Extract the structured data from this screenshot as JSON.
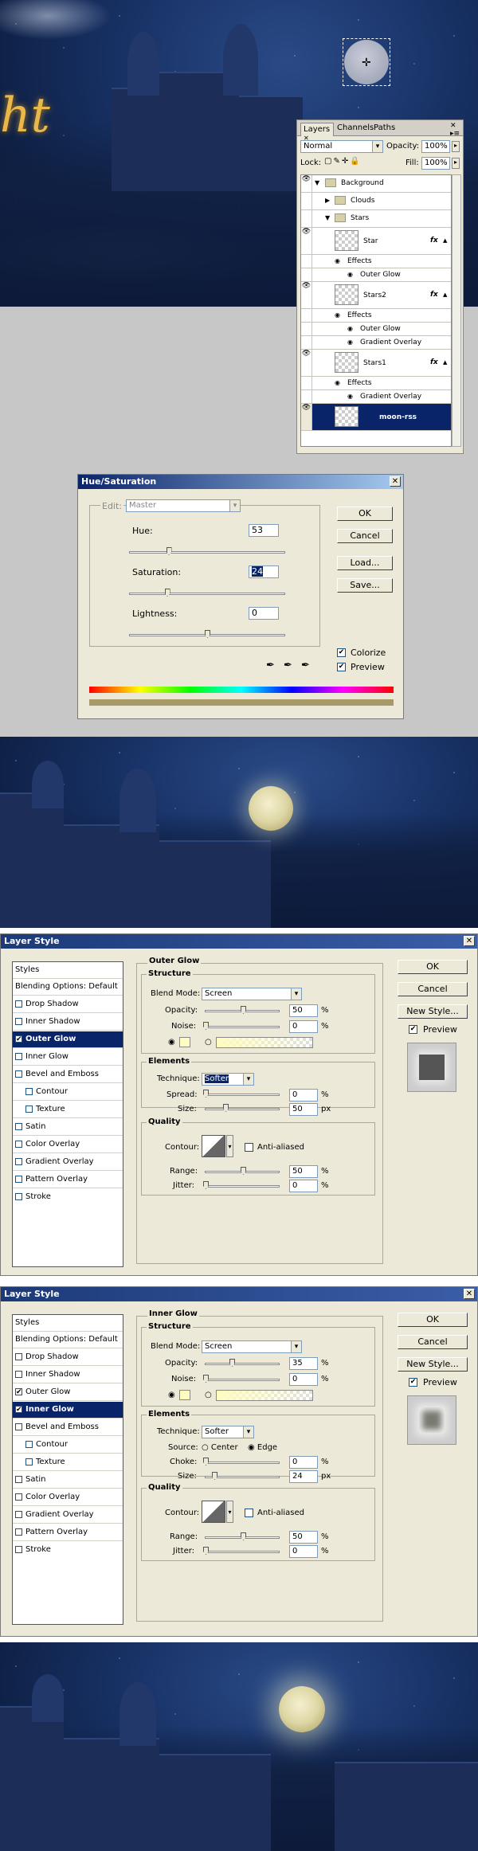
{
  "scene_top": {
    "script_text": "ht"
  },
  "layers_panel": {
    "tabs": [
      "Layers",
      "Channels",
      "Paths"
    ],
    "blend_mode": "Normal",
    "opacity_label": "Opacity:",
    "opacity_value": "100%",
    "lock_label": "Lock:",
    "fill_label": "Fill:",
    "fill_value": "100%",
    "rows": [
      {
        "label": "Background"
      },
      {
        "label": "Clouds"
      },
      {
        "label": "Stars"
      },
      {
        "label": "Star"
      },
      {
        "label": "Effects"
      },
      {
        "label": "Outer Glow"
      },
      {
        "label": "Stars2"
      },
      {
        "label": "Effects"
      },
      {
        "label": "Outer Glow"
      },
      {
        "label": "Gradient Overlay"
      },
      {
        "label": "Stars1"
      },
      {
        "label": "Effects"
      },
      {
        "label": "Gradient Overlay"
      },
      {
        "label": "moon-rss"
      }
    ],
    "fx": "fx"
  },
  "hue_sat": {
    "title": "Hue/Saturation",
    "edit_label": "Edit:",
    "edit_value": "Master",
    "hue_label": "Hue:",
    "hue_value": "53",
    "sat_label": "Saturation:",
    "sat_value": "24",
    "light_label": "Lightness:",
    "light_value": "0",
    "hue_level": 0.25,
    "sat_level": 0.24,
    "light_level": 0.5,
    "buttons": {
      "ok": "OK",
      "cancel": "Cancel",
      "load": "Load...",
      "save": "Save..."
    },
    "colorize": "Colorize",
    "preview": "Preview"
  },
  "layer_style_1": {
    "title": "Layer Style",
    "styles_header": "Styles",
    "blending": "Blending Options: Default",
    "items": [
      "Drop Shadow",
      "Inner Shadow",
      "Outer Glow",
      "Inner Glow",
      "Bevel and Emboss",
      "Contour",
      "Texture",
      "Satin",
      "Color Overlay",
      "Gradient Overlay",
      "Pattern Overlay",
      "Stroke"
    ],
    "section": "Outer Glow",
    "structure": "Structure",
    "blend_label": "Blend Mode:",
    "blend_value": "Screen",
    "opacity_label": "Opacity:",
    "opacity_value": "50",
    "noise_label": "Noise:",
    "noise_value": "0",
    "pct": "%",
    "elements": "Elements",
    "technique_label": "Technique:",
    "technique_value": "Softer",
    "spread_label": "Spread:",
    "spread_value": "0",
    "size_label": "Size:",
    "size_value": "50",
    "px": "px",
    "quality": "Quality",
    "contour_label": "Contour:",
    "antialiased": "Anti-aliased",
    "range_label": "Range:",
    "range_value": "50",
    "jitter_label": "Jitter:",
    "jitter_value": "0",
    "buttons": {
      "ok": "OK",
      "cancel": "Cancel",
      "new_style": "New Style...",
      "preview": "Preview"
    }
  },
  "layer_style_2": {
    "title": "Layer Style",
    "styles_header": "Styles",
    "blending": "Blending Options: Default",
    "items": [
      "Drop Shadow",
      "Inner Shadow",
      "Outer Glow",
      "Inner Glow",
      "Bevel and Emboss",
      "Contour",
      "Texture",
      "Satin",
      "Color Overlay",
      "Gradient Overlay",
      "Pattern Overlay",
      "Stroke"
    ],
    "section": "Inner Glow",
    "structure": "Structure",
    "blend_label": "Blend Mode:",
    "blend_value": "Screen",
    "opacity_label": "Opacity:",
    "opacity_value": "35",
    "noise_label": "Noise:",
    "noise_value": "0",
    "pct": "%",
    "elements": "Elements",
    "technique_label": "Technique:",
    "technique_value": "Softer",
    "source_label": "Source:",
    "center": "Center",
    "edge": "Edge",
    "choke_label": "Choke:",
    "choke_value": "0",
    "size_label": "Size:",
    "size_value": "24",
    "px": "px",
    "quality": "Quality",
    "contour_label": "Contour:",
    "antialiased": "Anti-aliased",
    "range_label": "Range:",
    "range_value": "50",
    "jitter_label": "Jitter:",
    "jitter_value": "0",
    "buttons": {
      "ok": "OK",
      "cancel": "Cancel",
      "new_style": "New Style...",
      "preview": "Preview"
    }
  }
}
